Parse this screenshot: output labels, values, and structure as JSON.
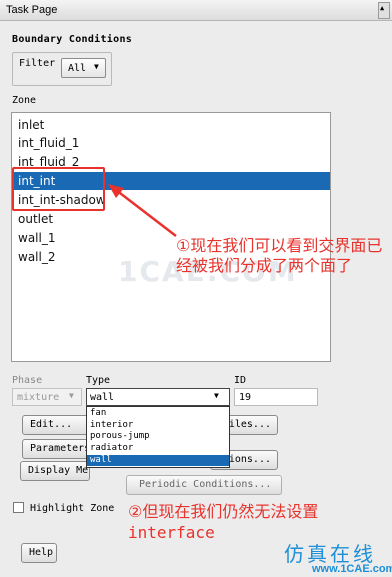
{
  "window": {
    "title": "Task Page"
  },
  "panel": {
    "title": "Boundary Conditions",
    "filter": {
      "label": "Filter",
      "value": "All"
    },
    "zone_label": "Zone",
    "zones": [
      {
        "label": "inlet",
        "selected": false
      },
      {
        "label": "int_fluid_1",
        "selected": false
      },
      {
        "label": "int_fluid_2",
        "selected": false
      },
      {
        "label": "int_int",
        "selected": true
      },
      {
        "label": "int_int-shadow",
        "selected": false
      },
      {
        "label": "outlet",
        "selected": false
      },
      {
        "label": "wall_1",
        "selected": false
      },
      {
        "label": "wall_2",
        "selected": false
      }
    ],
    "phase": {
      "label": "Phase",
      "value": "mixture"
    },
    "type": {
      "label": "Type",
      "value": "wall",
      "options": [
        "fan",
        "interior",
        "porous-jump",
        "radiator",
        "wall"
      ],
      "selected_option": "wall"
    },
    "id": {
      "label": "ID",
      "value": "19"
    },
    "buttons": {
      "edit": "Edit...",
      "profiles": "Profiles...",
      "parameters": "Parameters...",
      "operating": "Operating Conditions...",
      "display_mesh": "Display Mesh...",
      "periodic": "Periodic Conditions...",
      "help": "Help"
    },
    "highlight_zone": {
      "label": "Highlight Zone",
      "checked": false
    }
  },
  "annotations": {
    "note1": "①现在我们可以看到交界面已经被我们分成了两个面了",
    "note2": "②但现在我们仍然无法设置",
    "note3": "interface",
    "color": "#e8322c"
  },
  "watermarks": {
    "center": "1CAE.COM",
    "brand": "仿真在线",
    "url": "www.1CAE.com"
  }
}
